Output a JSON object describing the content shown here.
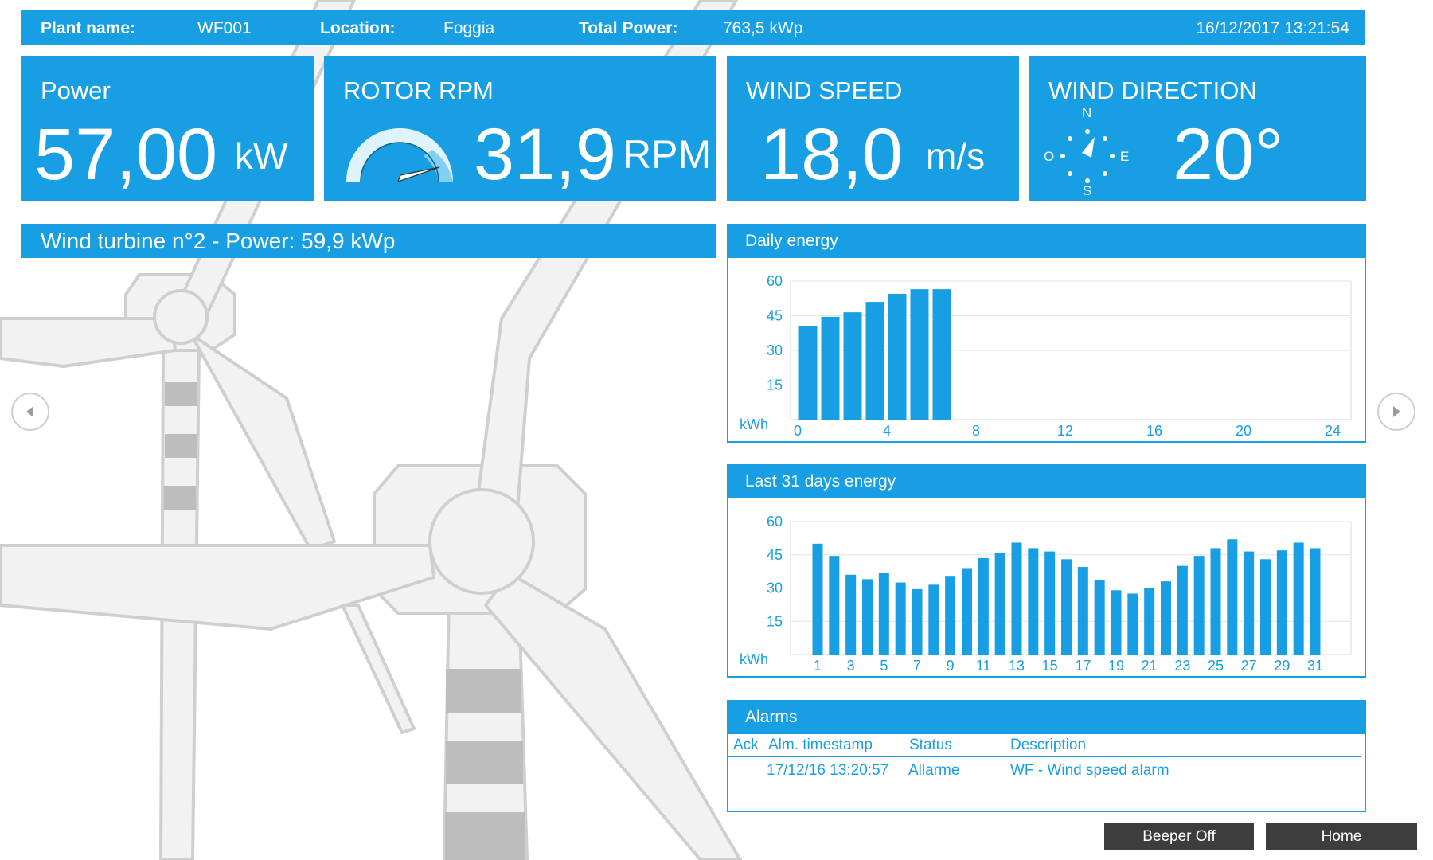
{
  "header": {
    "plant_label": "Plant name:",
    "plant_value": "WF001",
    "location_label": "Location:",
    "location_value": "Foggia",
    "total_power_label": "Total Power:",
    "total_power_value": "763,5 kWp",
    "datetime": "16/12/2017 13:21:54"
  },
  "tiles": {
    "power": {
      "title": "Power",
      "value": "57,00",
      "unit": "kW"
    },
    "rotor": {
      "title": "ROTOR RPM",
      "value": "31,9",
      "unit": "RPM"
    },
    "wind_speed": {
      "title": "WIND SPEED",
      "value": "18,0",
      "unit": "m/s"
    },
    "wind_direction": {
      "title": "WIND DIRECTION",
      "value": "20°",
      "compass": {
        "n": "N",
        "s": "S",
        "e": "E",
        "w": "O"
      }
    }
  },
  "turbine_title": "Wind turbine n°2 - Power: 59,9 kWp",
  "daily": {
    "title": "Daily energy"
  },
  "monthly": {
    "title": "Last 31 days energy"
  },
  "alarms": {
    "title": "Alarms",
    "columns": [
      "Ack",
      "Alm. timestamp",
      "Status",
      "Description"
    ],
    "rows": [
      {
        "ack": "",
        "timestamp": "17/12/16 13:20:57",
        "status": "Allarme",
        "description": "WF - Wind speed alarm"
      }
    ]
  },
  "buttons": {
    "beeper": "Beeper Off",
    "home": "Home"
  },
  "icons": {
    "prev": "chevron-left-icon",
    "next": "chevron-right-icon",
    "compass": "compass-icon",
    "gauge": "gauge-icon"
  },
  "colors": {
    "accent": "#189fe3",
    "button": "#3d3d3d",
    "illustration": "#d6d6d6"
  },
  "chart_data": [
    {
      "type": "bar",
      "title": "Daily energy",
      "ylabel": "kWh",
      "xlim": [
        0,
        24
      ],
      "ylim": [
        0,
        60
      ],
      "xticks": [
        0,
        4,
        8,
        12,
        16,
        20,
        24
      ],
      "yticks": [
        15,
        30,
        45,
        60
      ],
      "x": [
        1,
        2,
        3,
        4,
        5,
        6,
        7
      ],
      "values": [
        40.5,
        44.5,
        46.5,
        51,
        54.5,
        56.5,
        56.5
      ]
    },
    {
      "type": "bar",
      "title": "Last 31 days energy",
      "ylabel": "kWh",
      "ylim": [
        0,
        60
      ],
      "yticks": [
        15,
        30,
        45,
        60
      ],
      "xticks": [
        1,
        3,
        5,
        7,
        9,
        11,
        13,
        15,
        17,
        19,
        21,
        23,
        25,
        27,
        29,
        31
      ],
      "categories": [
        1,
        2,
        3,
        4,
        5,
        6,
        7,
        8,
        9,
        10,
        11,
        12,
        13,
        14,
        15,
        16,
        17,
        18,
        19,
        20,
        21,
        22,
        23,
        24,
        25,
        26,
        27,
        28,
        29,
        30,
        31
      ],
      "values": [
        50,
        44.5,
        36,
        34,
        37,
        32.5,
        29.5,
        31.5,
        35.5,
        39,
        43.5,
        46,
        50.5,
        48,
        46.5,
        43,
        39.5,
        33.5,
        29,
        27.5,
        30,
        33,
        40,
        44.5,
        48,
        52,
        46.5,
        43,
        47,
        50.5,
        48
      ]
    }
  ]
}
